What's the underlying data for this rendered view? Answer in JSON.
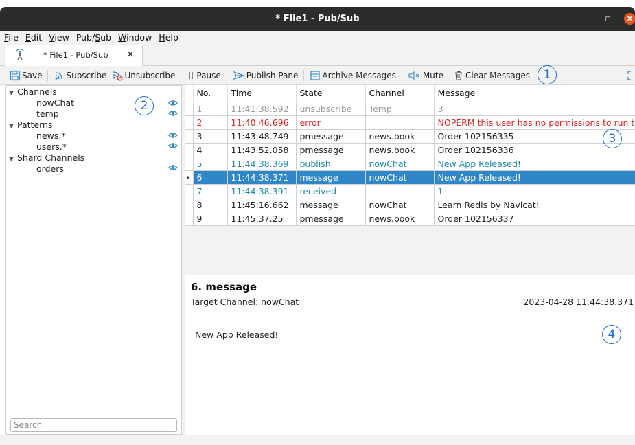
{
  "window": {
    "title": "* File1 - Pub/Sub",
    "minimize": "_",
    "maximize": "▫",
    "close": "×"
  },
  "menu": {
    "file": {
      "ul": "F",
      "rest": "ile"
    },
    "edit": {
      "ul": "E",
      "rest": "dit"
    },
    "view": {
      "ul": "V",
      "rest": "iew"
    },
    "pubsub": {
      "pre": "Pub/",
      "ul": "S",
      "rest": "ub"
    },
    "window": {
      "ul": "W",
      "rest": "indow"
    },
    "help": {
      "ul": "H",
      "rest": "elp"
    }
  },
  "tab": {
    "label": "* File1 - Pub/Sub",
    "close": "×"
  },
  "toolbar": {
    "save": "Save",
    "subscribe": "Subscribe",
    "unsubscribe": "Unsubscribe",
    "pause": "Pause",
    "publish_pane": "Publish Pane",
    "archive": "Archive Messages",
    "mute": "Mute",
    "clear": "Clear Messages"
  },
  "callouts": {
    "c1": "1",
    "c2": "2",
    "c3": "3",
    "c4": "4"
  },
  "tree": {
    "channels": {
      "label": "Channels",
      "items": [
        "nowChat",
        "temp"
      ]
    },
    "patterns": {
      "label": "Patterns",
      "items": [
        "news.*",
        "users.*"
      ]
    },
    "shard": {
      "label": "Shard Channels",
      "items": [
        "orders"
      ]
    }
  },
  "search": {
    "placeholder": "Search"
  },
  "table": {
    "headers": {
      "no": "No.",
      "time": "Time",
      "state": "State",
      "channel": "Channel",
      "message": "Message"
    },
    "rows": [
      {
        "no": "1",
        "time": "11:41:38.592",
        "state": "unsubscribe",
        "channel": "Temp",
        "message": "3"
      },
      {
        "no": "2",
        "time": "11:40:46.696",
        "state": "error",
        "channel": "",
        "message": "NOPERM this user has no permissions to run th..."
      },
      {
        "no": "3",
        "time": "11:43:48.749",
        "state": "pmessage",
        "channel": "news.book",
        "message": "Order 102156335"
      },
      {
        "no": "4",
        "time": "11:43:52.058",
        "state": "pmessage",
        "channel": "news.book",
        "message": "Order 102156336"
      },
      {
        "no": "5",
        "time": "11:44:38.369",
        "state": "publish",
        "channel": "nowChat",
        "message": "New App Released!"
      },
      {
        "no": "6",
        "time": "11:44:38.371",
        "state": "message",
        "channel": "nowChat",
        "message": "New App Released!"
      },
      {
        "no": "7",
        "time": "11:44:38.391",
        "state": "received",
        "channel": "-",
        "message": "1"
      },
      {
        "no": "8",
        "time": "11:45:16.662",
        "state": "message",
        "channel": "nowChat",
        "message": "Learn Redis by Navicat!"
      },
      {
        "no": "9",
        "time": "11:45:37.25",
        "state": "pmessage",
        "channel": "news.book",
        "message": "Order 102156337"
      }
    ],
    "current_marker": "▸"
  },
  "detail": {
    "title": "6. message",
    "channel": "Target Channel:  nowChat",
    "timestamp": "2023-04-28 11:44:38.371",
    "body": "New App Released!"
  },
  "colors": {
    "accent": "#1f6fd0",
    "selected": "#2f87c9",
    "error": "#e32626",
    "teal": "#1e8aa8",
    "muted": "#9a9a9a"
  }
}
